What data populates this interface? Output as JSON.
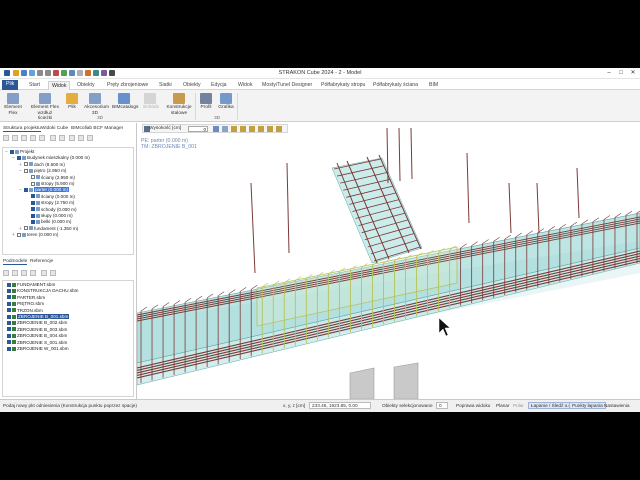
{
  "window": {
    "title": "STRAKON Cube 2024 - 2 - Model",
    "controls": [
      "–",
      "□",
      "✕"
    ]
  },
  "ribbon_tabs": [
    {
      "label": "Plik",
      "state": "file"
    },
    {
      "label": "Start",
      "state": ""
    },
    {
      "label": "Widok",
      "state": "active"
    },
    {
      "label": "Obiekty",
      "state": ""
    },
    {
      "label": "Pręty zbrojeniowe",
      "state": ""
    },
    {
      "label": "Siatki",
      "state": ""
    },
    {
      "label": "Obiekty",
      "state": ""
    },
    {
      "label": "Edycja",
      "state": ""
    },
    {
      "label": "Widok",
      "state": ""
    },
    {
      "label": "Mosty/Tunel Designer",
      "state": ""
    },
    {
      "label": "Półfabrykaty stropu",
      "state": ""
    },
    {
      "label": "Półfabrykaty ściana",
      "state": ""
    },
    {
      "label": "BIM",
      "state": ""
    }
  ],
  "ribbon": {
    "buttons": [
      {
        "label": "Element",
        "label2": "Flex",
        "icon": "element-flex-icon",
        "disabled": false
      },
      {
        "label": "Element Flex",
        "label2": "wzdłuż ścieżki",
        "icon": "element-flex-path-icon",
        "disabled": false
      },
      {
        "label": "Plik",
        "label2": "",
        "icon": "folder-icon",
        "disabled": false
      },
      {
        "label": "Akcesorium",
        "label2": "3D",
        "icon": "accessory-3d-icon",
        "disabled": false
      },
      {
        "label": "BIMcatalogs",
        "label2": "",
        "icon": "bim-catalogs-icon",
        "disabled": false
      },
      {
        "label": "Schöck",
        "label2": "",
        "icon": "schoeck-icon",
        "disabled": true
      },
      {
        "label": "Konstrukcje",
        "label2": "stalowe",
        "icon": "steel-structure-icon",
        "disabled": false
      },
      {
        "label": "Profil",
        "label2": "",
        "icon": "profile-icon",
        "disabled": false
      },
      {
        "label": "Grafika",
        "label2": "",
        "icon": "graphics-icon",
        "disabled": false
      }
    ],
    "groups": [
      "3D",
      "3D"
    ]
  },
  "panel": {
    "tabs": [
      "Struktura projektu",
      "Widoki Cube",
      "BIMcollab BCF Manager"
    ],
    "tree": [
      {
        "label": "Projekt",
        "depth": 0,
        "exp": "−",
        "checked": true,
        "sel": ""
      },
      {
        "label": "Budynek mieszkalny (0.000 m)",
        "depth": 1,
        "exp": "−",
        "checked": true,
        "sel": ""
      },
      {
        "label": "dach (8.600 m)",
        "depth": 2,
        "exp": "+",
        "checked": false,
        "sel": ""
      },
      {
        "label": "piętro (2.950 m)",
        "depth": 2,
        "exp": "−",
        "checked": false,
        "sel": ""
      },
      {
        "label": "ściany (2.950 m)",
        "depth": 3,
        "exp": "",
        "checked": false,
        "sel": ""
      },
      {
        "label": "stropy (5.900 m)",
        "depth": 3,
        "exp": "",
        "checked": false,
        "sel": ""
      },
      {
        "label": "parter (0.000 m)",
        "depth": 2,
        "exp": "−",
        "checked": true,
        "sel": "hl"
      },
      {
        "label": "ściany (0.000 m)",
        "depth": 3,
        "exp": "",
        "checked": true,
        "sel": ""
      },
      {
        "label": "stropy (2.750 m)",
        "depth": 3,
        "exp": "",
        "checked": true,
        "sel": ""
      },
      {
        "label": "schody (0.000 m)",
        "depth": 3,
        "exp": "",
        "checked": true,
        "sel": ""
      },
      {
        "label": "słupy (0.000 m)",
        "depth": 3,
        "exp": "",
        "checked": true,
        "sel": ""
      },
      {
        "label": "belki (0.000 m)",
        "depth": 3,
        "exp": "",
        "checked": true,
        "sel": ""
      },
      {
        "label": "fundament (-1.350 m)",
        "depth": 2,
        "exp": "+",
        "checked": false,
        "sel": ""
      },
      {
        "label": "teren (0.000 m)",
        "depth": 1,
        "exp": "+",
        "checked": false,
        "sel": ""
      }
    ],
    "sub_tabs": [
      "Podmodele",
      "Referencje"
    ],
    "podmodele": [
      {
        "label": "FUNDAMENT.sbm",
        "sel": false
      },
      {
        "label": "KONSTRUKCJA DACHU.sbm",
        "sel": false
      },
      {
        "label": "PARTER.sbm",
        "sel": false
      },
      {
        "label": "PIĘTRO.sbm",
        "sel": false
      },
      {
        "label": "TRZON.sbm",
        "sel": false
      },
      {
        "label": "ZBROJENIE B_001.sbm",
        "sel": true
      },
      {
        "label": "ZBROJENIE B_002.sbm",
        "sel": false
      },
      {
        "label": "ZBROJENIE B_003.sbm",
        "sel": false
      },
      {
        "label": "ZBROJENIE B_004.sbm",
        "sel": false
      },
      {
        "label": "ZBROJENIE S_001.sbm",
        "sel": false
      },
      {
        "label": "ZBROJENIE W_001.sbm",
        "sel": false
      }
    ]
  },
  "viewport": {
    "height_label": "Wysokość [cm]",
    "height_value": "0",
    "info_line1": "PE: parter (0.000 m)",
    "info_line2": "TM: ZBROJENIE B_001",
    "colors": {
      "concrete": "#8fd4d2",
      "concrete_edge": "#5aa7a6",
      "rebar": "#7a3a36",
      "rebar_selected": "#b7c25a",
      "column": "#c9c9c9"
    }
  },
  "statusbar": {
    "prompt": "Podaj nowy pkt odniesienia (Konstrukcja punktu poprzez spacje)",
    "coord_label": "x, y, z [cm]",
    "coords": "233.46, 1923.85, 0.00",
    "selected": "Obiekty selekcjonowane",
    "selected_count": "0",
    "items": [
      {
        "label": "Poprawa widoku",
        "state": ""
      },
      {
        "label": "Planar",
        "state": ""
      },
      {
        "label": "Polar",
        "state": "muted"
      },
      {
        "label": "Łapanie / Śledź o.c.",
        "state": "act"
      },
      {
        "label": "Punkty łapania",
        "state": "act"
      },
      {
        "label": "Nastawienia",
        "state": ""
      }
    ]
  }
}
